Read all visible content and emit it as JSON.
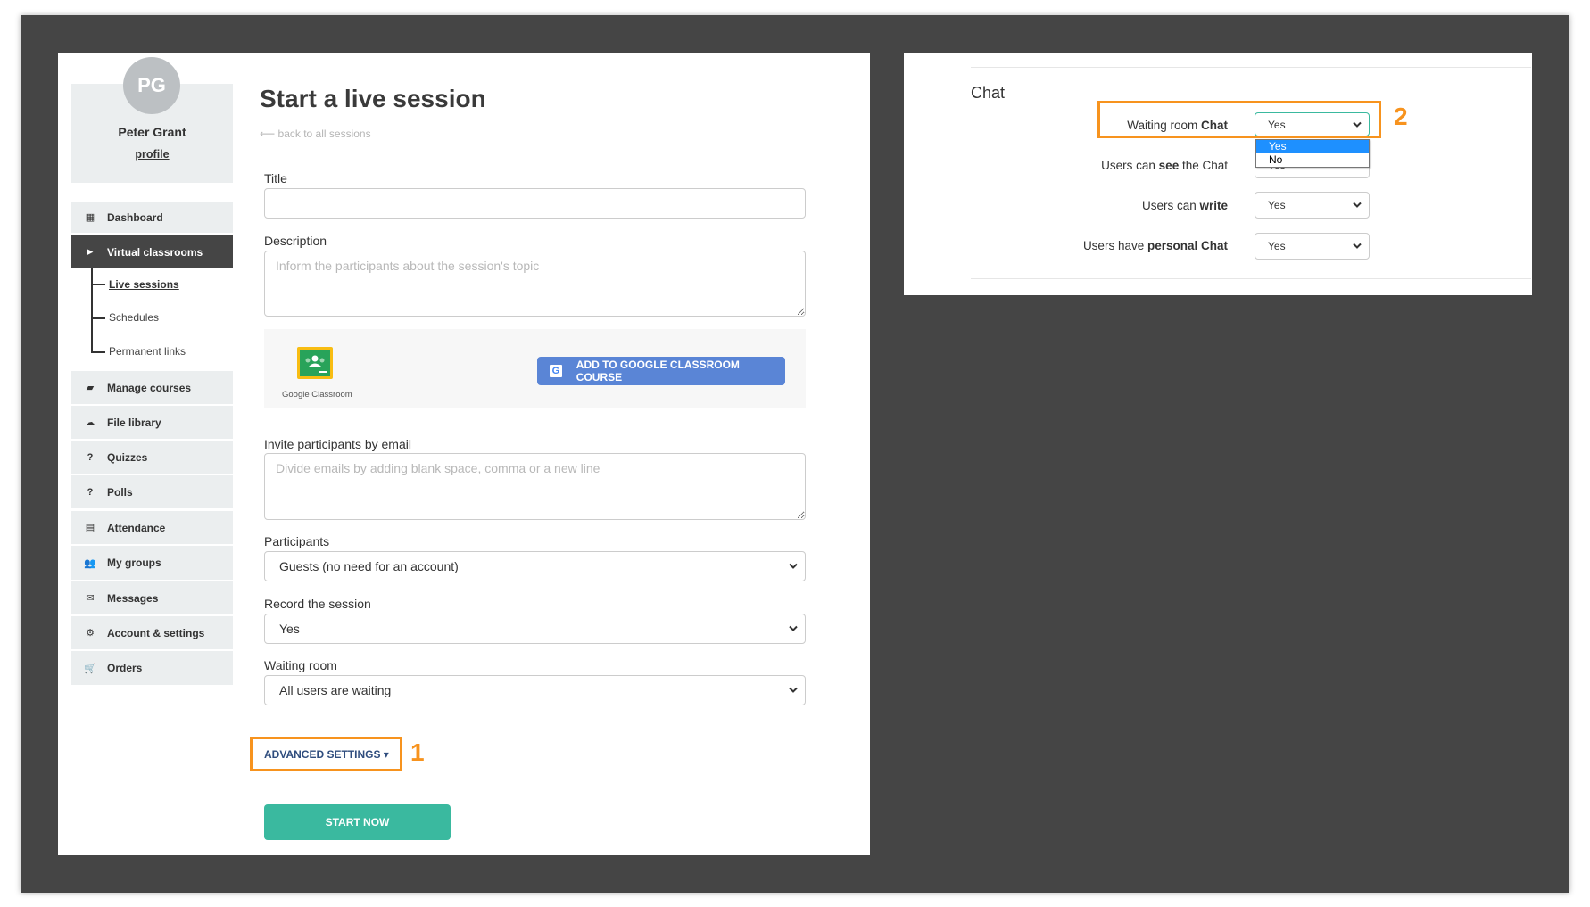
{
  "user": {
    "initials": "PG",
    "name": "Peter Grant",
    "profile_link": "profile"
  },
  "sidebar": {
    "items": [
      {
        "label": "Dashboard",
        "icon": "dashboard-grid-icon",
        "glyph": "▦"
      },
      {
        "label": "Virtual classrooms",
        "icon": "play-circle-icon",
        "glyph": "▶",
        "active": true
      },
      {
        "label": "Manage courses",
        "icon": "book-icon",
        "glyph": "▰"
      },
      {
        "label": "File library",
        "icon": "cloud-upload-icon",
        "glyph": "☁"
      },
      {
        "label": "Quizzes",
        "icon": "question-circle-icon",
        "glyph": "?"
      },
      {
        "label": "Polls",
        "icon": "question-circle-icon",
        "glyph": "?"
      },
      {
        "label": "Attendance",
        "icon": "document-icon",
        "glyph": "▤"
      },
      {
        "label": "My groups",
        "icon": "users-icon",
        "glyph": "👥"
      },
      {
        "label": "Messages",
        "icon": "envelope-icon",
        "glyph": "✉"
      },
      {
        "label": "Account & settings",
        "icon": "gear-icon",
        "glyph": "⚙"
      },
      {
        "label": "Orders",
        "icon": "cart-icon",
        "glyph": "🛒"
      }
    ],
    "subitems": [
      {
        "label": "Live sessions",
        "current": true
      },
      {
        "label": "Schedules"
      },
      {
        "label": "Permanent links"
      }
    ]
  },
  "main": {
    "title": "Start a live session",
    "back_link": "⟵ back to all sessions",
    "title_label": "Title",
    "title_value": "",
    "description_label": "Description",
    "description_placeholder": "Inform the participants about the session's topic",
    "google_classroom_label": "Google Classroom",
    "google_button": "ADD TO GOOGLE CLASSROOM COURSE",
    "invite_label": "Invite participants by email",
    "invite_placeholder": "Divide emails by adding blank space, comma or a new line",
    "participants_label": "Participants",
    "participants_value": "Guests (no need for an account)",
    "record_label": "Record the session",
    "record_value": "Yes",
    "waiting_label": "Waiting room",
    "waiting_value": "All users are waiting",
    "advanced_settings": "ADVANCED SETTINGS ▾",
    "start_button": "START NOW"
  },
  "annotations": {
    "step1": "1",
    "step2": "2",
    "color": "#f7931e"
  },
  "chat": {
    "heading": "Chat",
    "rows": [
      {
        "pre": "Waiting room ",
        "bold": "Chat",
        "post": "",
        "value": "Yes"
      },
      {
        "pre": "Users can ",
        "bold": "see",
        "post": " the Chat",
        "value": "Yes"
      },
      {
        "pre": "Users can ",
        "bold": "write",
        "post": "",
        "value": "Yes"
      },
      {
        "pre": "Users have ",
        "bold": "personal Chat",
        "post": "",
        "value": "Yes"
      }
    ],
    "dropdown_options": [
      "Yes",
      "No"
    ],
    "dropdown_selected": "Yes"
  },
  "colors": {
    "accent_green": "#3ab99f",
    "google_blue": "#5a85d6",
    "sidebar_active": "#454545",
    "annotation": "#f7931e"
  }
}
